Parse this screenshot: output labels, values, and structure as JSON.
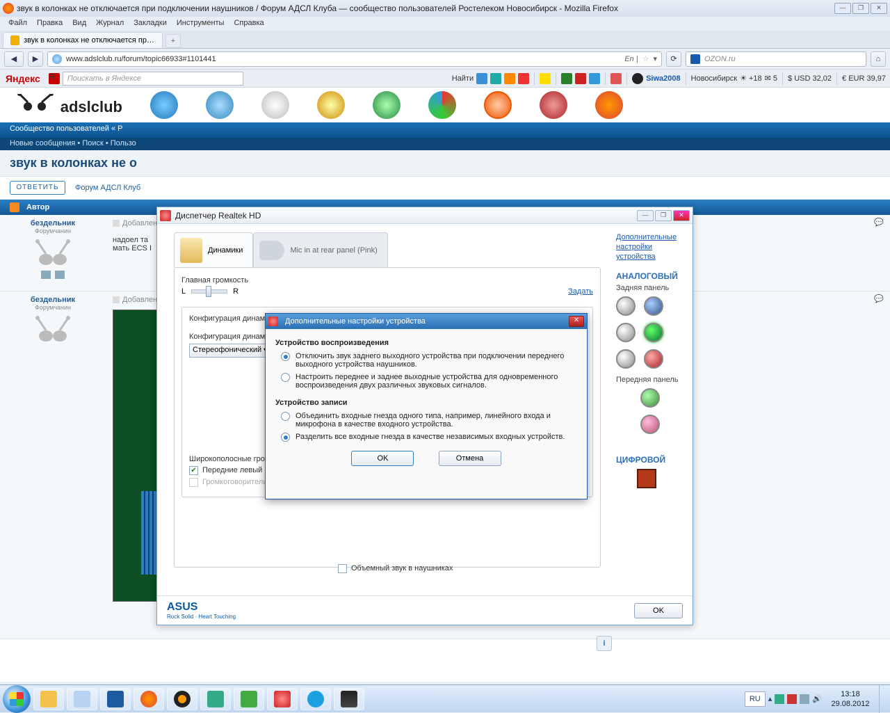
{
  "firefox": {
    "title": "звук в колонках не отключается при подключении наушников / Форум АДСЛ Клуба — сообщество пользователей Ростелеком Новосибирск - Mozilla Firefox",
    "menu": [
      "Файл",
      "Правка",
      "Вид",
      "Журнал",
      "Закладки",
      "Инструменты",
      "Справка"
    ],
    "tab_label": "звук в колонках не отключается при п...",
    "url": "www.adslclub.ru/forum/topic66933#1101441",
    "search_placeholder": "OZON.ru",
    "meta_indicator": "En |",
    "home_icon": "⌂"
  },
  "toolbar2": {
    "yandex_label": "Яндекс",
    "search_placeholder": "Поискать в Яндексе",
    "find_label": "Найти",
    "user": "Siwa2008",
    "city": "Новосибирск",
    "weather": "☀ +18",
    "mail": "✉ 5",
    "usd": "$ USD 32,02",
    "eur": "€ EUR 39,97"
  },
  "site": {
    "logo_main": "adslclub",
    "subhead": "Сообщество пользователей « Р",
    "subnav": "Новые сообщения • Поиск • Пользо",
    "topic": "звук в колонках не о",
    "reply": "ОТВЕТИТЬ",
    "crumb": "Форум АДСЛ Клуб",
    "author_col": "Автор",
    "post1": {
      "user": "бездельник",
      "rank": "Форумчанин",
      "meta_added": "Добавлено",
      "text1": "надоел та",
      "text2": "мать ECS I"
    },
    "post2": {
      "user": "бездельник",
      "rank": "Форумчанин",
      "meta_added": "Добавлено"
    }
  },
  "realtek": {
    "title": "Диспетчер Realtek HD",
    "tab_speakers": "Динамики",
    "tab_mic": "Mic in at rear panel (Pink)",
    "main_volume": "Главная громкость",
    "L": "L",
    "R": "R",
    "set_btn": "Задать",
    "cfg_title": "Конфигурация динами",
    "cfg_label": "Конфигурация динами",
    "cfg_value": "Стереофонический",
    "wb_label": "Широкополосные громкоговорители",
    "wb_front": "Передние левый и правый",
    "wb_surround": "Громкоговорители объемного звука",
    "surround_hp": "Объемный звук в наушниках",
    "asus": "ASUS",
    "asus_sub": "Rock Solid · Heart Touching",
    "ok": "OK",
    "side": {
      "link": "Дополнительные настройки устройства",
      "analog": "АНАЛОГОВЫЙ",
      "rear": "Задняя панель",
      "front": "Передняя панель",
      "digital": "ЦИФРОВОЙ"
    }
  },
  "dialog": {
    "title": "Дополнительные настройки устройства",
    "playback_h": "Устройство воспроизведения",
    "pb_opt1": "Отключить звук заднего выходного устройства при подключении переднего выходного устройства наушников.",
    "pb_opt2": "Настроить переднее и заднее выходные устройства для одновременного воспроизведения двух различных звуковых сигналов.",
    "record_h": "Устройство записи",
    "rc_opt1": "Объединить входные гнезда одного типа, например, линейного входа и микрофона в качестве входного устройства.",
    "rc_opt2": "Разделить все входные гнезда в качестве независимых входных устройств.",
    "ok": "OK",
    "cancel": "Отмена"
  },
  "taskbar": {
    "lang": "RU",
    "time": "13:18",
    "date": "29.08.2012"
  }
}
